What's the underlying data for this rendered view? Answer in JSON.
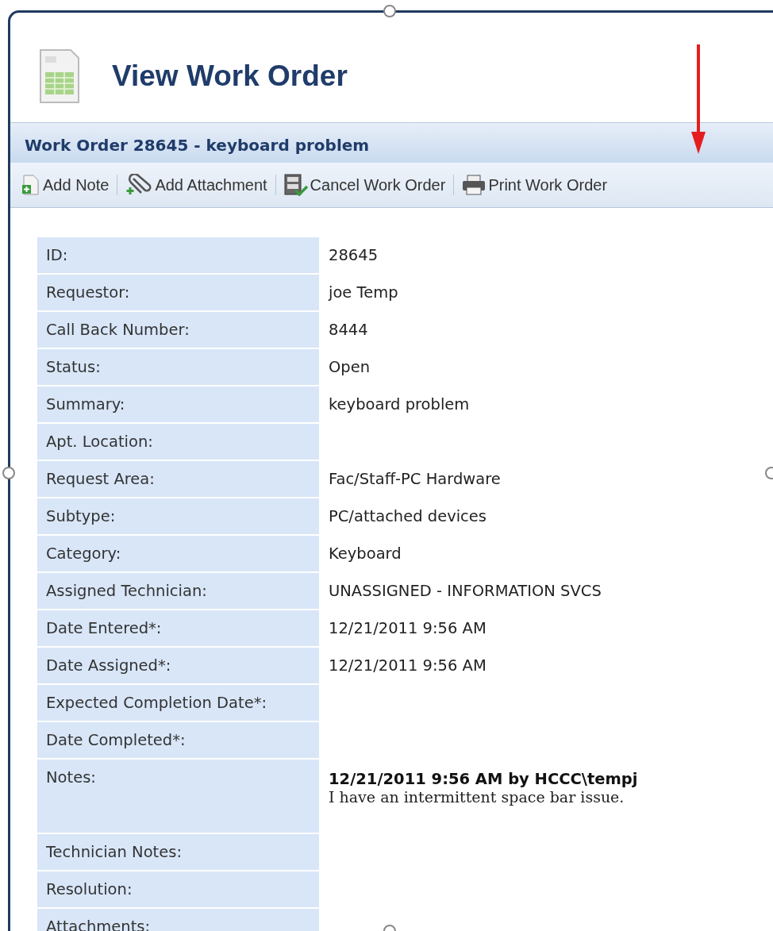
{
  "title": "View Work Order",
  "panel": {
    "title": "Work Order 28645 - keyboard problem",
    "toolbar": [
      {
        "kind": "note",
        "label": "Add Note"
      },
      {
        "kind": "attachment",
        "label": "Add Attachment"
      },
      {
        "kind": "cancel",
        "label": "Cancel Work Order"
      },
      {
        "kind": "print",
        "label": "Print Work Order"
      }
    ]
  },
  "fields": [
    {
      "label": "ID:",
      "value": "28645"
    },
    {
      "label": "Requestor:",
      "value": "joe Temp"
    },
    {
      "label": "Call Back Number:",
      "value": "8444"
    },
    {
      "label": "Status:",
      "value": "Open"
    },
    {
      "label": "Summary:",
      "value": "keyboard problem"
    },
    {
      "label": "Apt. Location:"
    },
    {
      "label": "Request Area:",
      "value": "Fac/Staff-PC Hardware"
    },
    {
      "label": "Subtype:",
      "value": "PC/attached devices"
    },
    {
      "label": "Category:",
      "value": "Keyboard"
    },
    {
      "label": "Assigned Technician:",
      "value": "UNASSIGNED - INFORMATION SVCS"
    },
    {
      "label": "Date Entered*:",
      "value": "12/21/2011 9:56 AM"
    },
    {
      "label": "Date Assigned*:",
      "value": "12/21/2011 9:56 AM"
    },
    {
      "label": "Expected Completion Date*:"
    },
    {
      "label": "Date Completed*:"
    },
    {
      "label": "Notes:",
      "kind": "note",
      "note": {
        "heading": "12/21/2011 9:56 AM by HCCC\\tempj",
        "text": "I have an intermittent space bar issue."
      }
    },
    {
      "label": "Technician Notes:"
    },
    {
      "label": "Resolution:"
    },
    {
      "label": "Attachments:"
    }
  ]
}
